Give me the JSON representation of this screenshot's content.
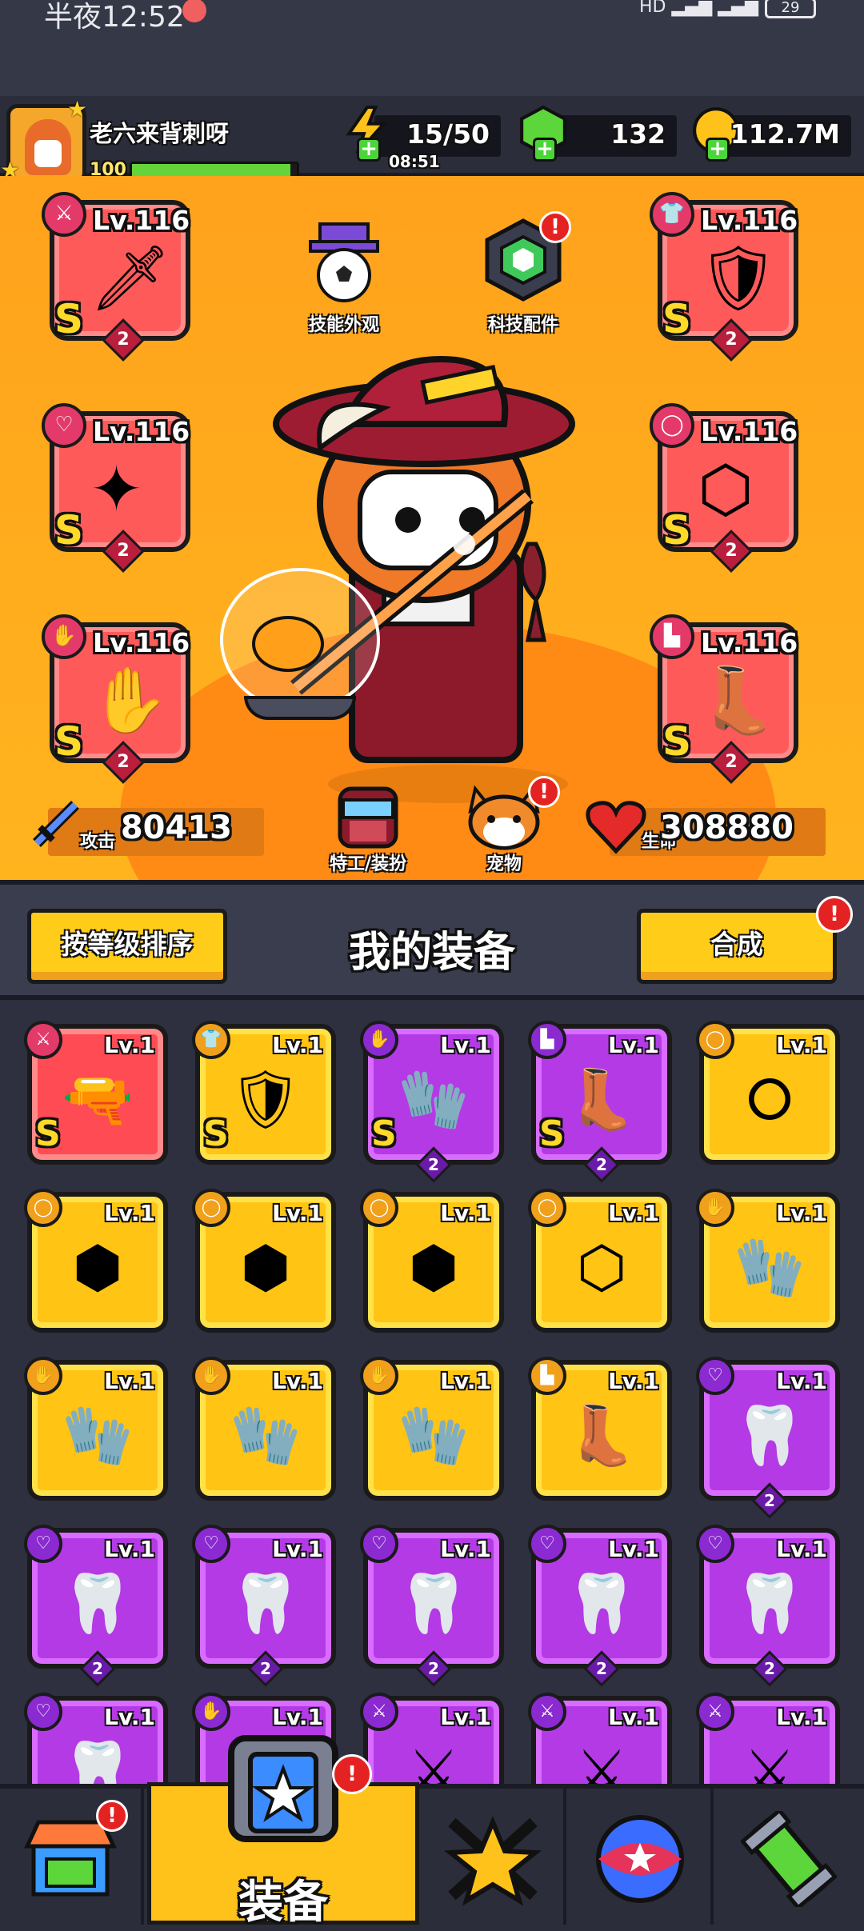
{
  "status_bar": {
    "time": "半夜12:52",
    "battery": "29"
  },
  "player": {
    "name": "老六来背刺呀",
    "level": "100",
    "xp_progress": 0.96
  },
  "resources": {
    "energy": {
      "value": "15/50",
      "timer": "08:51",
      "icon": "lightning-icon"
    },
    "gems": {
      "value": "132",
      "icon": "gem-icon"
    },
    "coins": {
      "value": "112.7M",
      "icon": "coin-icon"
    }
  },
  "hero": {
    "equipped": [
      {
        "slot": "weapon",
        "level": "Lv.116",
        "rank": "S",
        "count": "2",
        "icon": "sword-icon",
        "glyph": "🗡"
      },
      {
        "slot": "armor",
        "level": "Lv.116",
        "rank": "S",
        "count": "2",
        "icon": "armor-icon",
        "glyph": "🛡"
      },
      {
        "slot": "necklace",
        "level": "Lv.116",
        "rank": "S",
        "count": "2",
        "icon": "necklace-icon",
        "glyph": "✦"
      },
      {
        "slot": "belt",
        "level": "Lv.116",
        "rank": "S",
        "count": "2",
        "icon": "belt-icon",
        "glyph": "⬡"
      },
      {
        "slot": "gloves",
        "level": "Lv.116",
        "rank": "S",
        "count": "2",
        "icon": "glove-icon",
        "glyph": "✋"
      },
      {
        "slot": "boots",
        "level": "Lv.116",
        "rank": "S",
        "count": "2",
        "icon": "boot-icon",
        "glyph": "👢"
      }
    ],
    "skill_skin_label": "技能外观",
    "tech_parts_label": "科技配件",
    "agent_skin_label": "特工/装扮",
    "pet_label": "宠物",
    "attack_label": "攻击",
    "attack_value": "80413",
    "hp_label": "生命",
    "hp_value": "308880"
  },
  "inventory_bar": {
    "sort_label": "按等级排序",
    "title": "我的装备",
    "merge_label": "合成"
  },
  "items": [
    {
      "level": "Lv.1",
      "rank": "S",
      "color": "red",
      "icon": "gun-icon",
      "glyph": "🔫",
      "count": ""
    },
    {
      "level": "Lv.1",
      "rank": "S",
      "color": "yellow",
      "icon": "armor-icon",
      "glyph": "🛡",
      "count": ""
    },
    {
      "level": "Lv.1",
      "rank": "S",
      "color": "purple",
      "icon": "glove-icon",
      "glyph": "🧤",
      "count": "2"
    },
    {
      "level": "Lv.1",
      "rank": "S",
      "color": "purple",
      "icon": "boot-icon",
      "glyph": "👢",
      "count": "2"
    },
    {
      "level": "Lv.1",
      "rank": "",
      "color": "yellow",
      "icon": "belt-icon",
      "glyph": "⭘",
      "count": ""
    },
    {
      "level": "Lv.1",
      "rank": "",
      "color": "yellow",
      "icon": "belt-icon",
      "glyph": "⬢",
      "count": ""
    },
    {
      "level": "Lv.1",
      "rank": "",
      "color": "yellow",
      "icon": "belt-icon",
      "glyph": "⬢",
      "count": ""
    },
    {
      "level": "Lv.1",
      "rank": "",
      "color": "yellow",
      "icon": "belt-icon",
      "glyph": "⬢",
      "count": ""
    },
    {
      "level": "Lv.1",
      "rank": "",
      "color": "yellow",
      "icon": "belt-icon",
      "glyph": "⬡",
      "count": ""
    },
    {
      "level": "Lv.1",
      "rank": "",
      "color": "yellow",
      "icon": "glove-icon",
      "glyph": "🧤",
      "count": ""
    },
    {
      "level": "Lv.1",
      "rank": "",
      "color": "yellow",
      "icon": "glove-icon",
      "glyph": "🧤",
      "count": ""
    },
    {
      "level": "Lv.1",
      "rank": "",
      "color": "yellow",
      "icon": "glove-icon",
      "glyph": "🧤",
      "count": ""
    },
    {
      "level": "Lv.1",
      "rank": "",
      "color": "yellow",
      "icon": "glove-icon",
      "glyph": "🧤",
      "count": ""
    },
    {
      "level": "Lv.1",
      "rank": "",
      "color": "yellow",
      "icon": "boot-icon",
      "glyph": "👢",
      "count": ""
    },
    {
      "level": "Lv.1",
      "rank": "",
      "color": "purple",
      "icon": "necklace-icon",
      "glyph": "🦷",
      "count": "2"
    },
    {
      "level": "Lv.1",
      "rank": "",
      "color": "purple",
      "icon": "necklace-icon",
      "glyph": "🦷",
      "count": "2"
    },
    {
      "level": "Lv.1",
      "rank": "",
      "color": "purple",
      "icon": "necklace-icon",
      "glyph": "🦷",
      "count": "2"
    },
    {
      "level": "Lv.1",
      "rank": "",
      "color": "purple",
      "icon": "necklace-icon",
      "glyph": "🦷",
      "count": "2"
    },
    {
      "level": "Lv.1",
      "rank": "",
      "color": "purple",
      "icon": "necklace-icon",
      "glyph": "🦷",
      "count": "2"
    },
    {
      "level": "Lv.1",
      "rank": "",
      "color": "purple",
      "icon": "necklace-icon",
      "glyph": "🦷",
      "count": "2"
    },
    {
      "level": "Lv.1",
      "rank": "",
      "color": "purple",
      "icon": "necklace-icon",
      "glyph": "🦷",
      "count": ""
    },
    {
      "level": "Lv.1",
      "rank": "",
      "color": "purple",
      "icon": "glove-icon",
      "glyph": "🧤",
      "count": ""
    },
    {
      "level": "Lv.1",
      "rank": "",
      "color": "purple",
      "icon": "kunai-icon",
      "glyph": "⚔",
      "count": ""
    },
    {
      "level": "Lv.1",
      "rank": "",
      "color": "purple",
      "icon": "kunai-icon",
      "glyph": "⚔",
      "count": ""
    },
    {
      "level": "Lv.1",
      "rank": "",
      "color": "purple",
      "icon": "kunai-icon",
      "glyph": "⚔",
      "count": ""
    }
  ],
  "nav": {
    "shop_icon": "shop-icon",
    "equipment_label": "装备",
    "battle_icon": "battle-star-icon",
    "ball_icon": "star-ball-icon",
    "dna_icon": "dna-capsule-icon"
  },
  "colors": {
    "accent": "#ffc21a",
    "item_red": "#ff4b54",
    "item_yellow": "#ffc414",
    "item_purple": "#b43ae6",
    "alert": "#e52222"
  }
}
